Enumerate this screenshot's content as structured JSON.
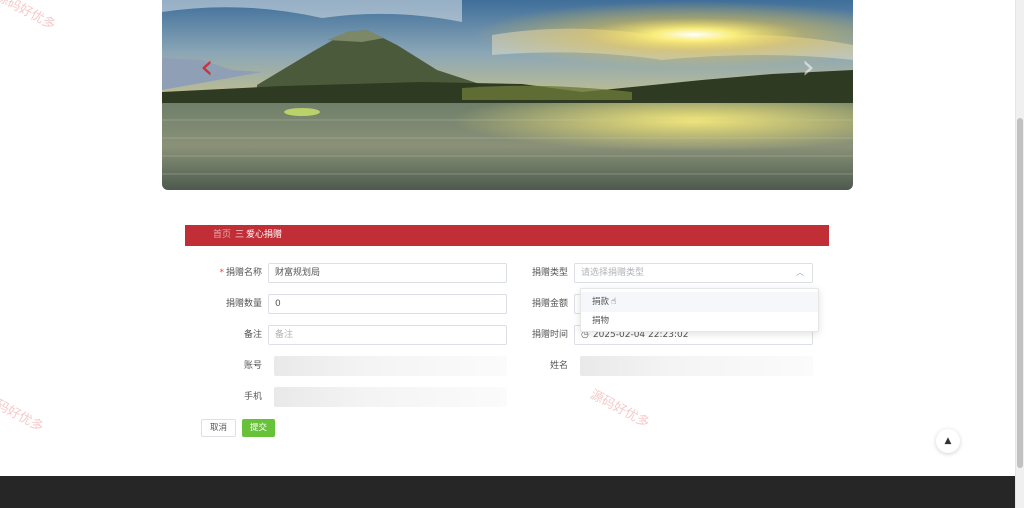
{
  "banner": {
    "prev_arrow": "‹",
    "next_arrow": "›"
  },
  "breadcrumb": {
    "home": "首页",
    "separator": "三",
    "current": "爱心捐赠"
  },
  "form": {
    "name_required_mark": "*",
    "name_label": "捐赠名称",
    "name_value": "财富规划局",
    "type_label": "捐赠类型",
    "type_placeholder": "请选择捐赠类型",
    "quantity_label": "捐赠数量",
    "quantity_value": "0",
    "amount_label": "捐赠金额",
    "remark_label": "备注",
    "remark_placeholder": "备注",
    "time_label": "捐赠时间",
    "time_value": "2025-02-04 22:23:02",
    "account_label": "账号",
    "name2_label": "姓名",
    "phone_label": "手机"
  },
  "dropdown": {
    "options": [
      "捐款",
      "捐物"
    ],
    "hovered": "捐款"
  },
  "buttons": {
    "cancel": "取消",
    "submit": "提交"
  },
  "back_to_top": "▲",
  "watermark": "源码好优多",
  "icons": {
    "select_caret": "chevron-up-icon",
    "time": "clock-icon",
    "cursor": "hand-pointer-icon"
  }
}
